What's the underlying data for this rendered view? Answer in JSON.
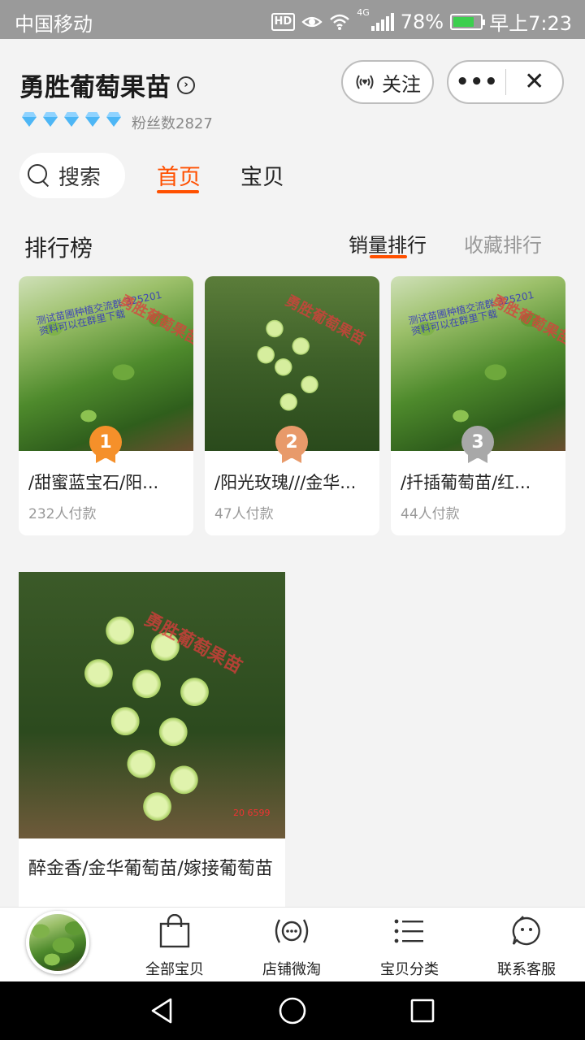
{
  "status_bar": {
    "carrier": "中国移动",
    "hd": "HD",
    "network": "4G",
    "battery": "78%",
    "battery_level": 0.78,
    "time": "早上7:23"
  },
  "shop": {
    "name": "勇胜葡萄果苗",
    "diamond_count": 5,
    "fans": "粉丝数2827",
    "follow_label": "关注",
    "more_label": "•••",
    "close_label": "✕"
  },
  "nav": {
    "search_label": "搜索",
    "tabs": [
      {
        "label": "首页",
        "active": true
      },
      {
        "label": "宝贝",
        "active": false
      }
    ]
  },
  "ranking": {
    "title": "排行榜",
    "sort_tabs": [
      {
        "label": "销量排行",
        "active": true
      },
      {
        "label": "收藏排行",
        "active": false
      }
    ],
    "top_items": [
      {
        "rank": "1",
        "title": "/甜蜜蓝宝石/阳...",
        "sales": "232人付款"
      },
      {
        "rank": "2",
        "title": "/阳光玫瑰///金华...",
        "sales": "47人付款"
      },
      {
        "rank": "3",
        "title": "/扦插葡萄苗/红...",
        "sales": "44人付款"
      }
    ],
    "featured": {
      "title": "醉金香/金华葡萄苗/嫁接葡萄苗"
    }
  },
  "watermarks": {
    "shop": "勇胜葡萄果苗",
    "blue_line1": "测试苗圃种植交流群 325201",
    "blue_line2": "资料可以在群里下载",
    "date": "20 6599"
  },
  "bottom_bar": {
    "items": [
      {
        "label": "全部宝贝",
        "icon": "shopping-bag-icon"
      },
      {
        "label": "店铺微淘",
        "icon": "broadcast-icon"
      },
      {
        "label": "宝贝分类",
        "icon": "list-icon"
      },
      {
        "label": "联系客服",
        "icon": "chat-face-icon"
      }
    ]
  },
  "colors": {
    "accent": "#ff5000",
    "status_bar": "#9a9a9a",
    "medal_gold": "#f5902a",
    "medal_bronze": "#e89a6a",
    "medal_silver": "#a8a8a8"
  }
}
